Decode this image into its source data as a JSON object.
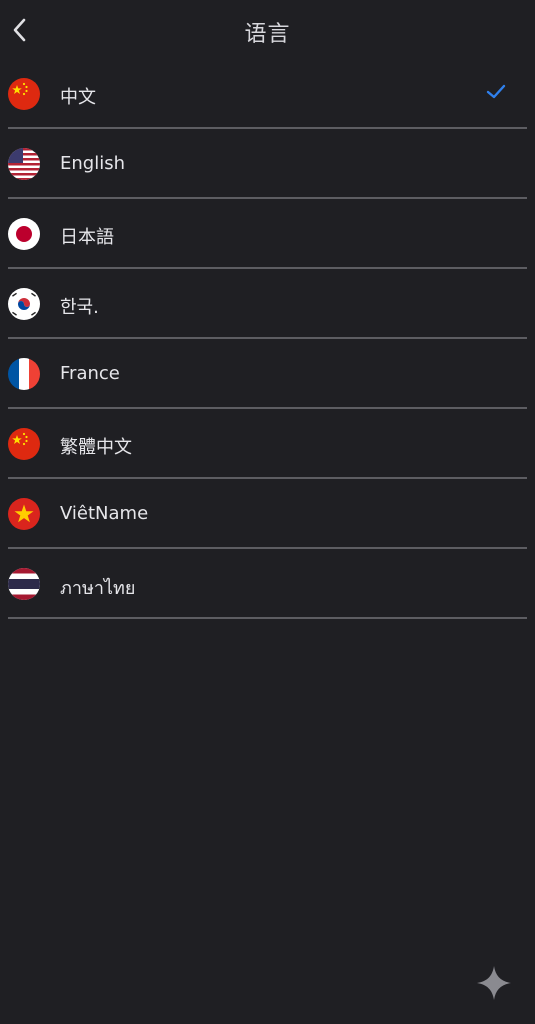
{
  "header": {
    "back_icon": "chevron-left-icon",
    "title": "语言"
  },
  "languages": [
    {
      "label": "中文",
      "flag": "china-flag-icon",
      "selected": true
    },
    {
      "label": "English",
      "flag": "usa-flag-icon",
      "selected": false
    },
    {
      "label": "日本語",
      "flag": "japan-flag-icon",
      "selected": false
    },
    {
      "label": "한국.",
      "flag": "korea-flag-icon",
      "selected": false
    },
    {
      "label": "France",
      "flag": "france-flag-icon",
      "selected": false
    },
    {
      "label": "繁體中文",
      "flag": "china-flag-icon",
      "selected": false
    },
    {
      "label": "ViêtName",
      "flag": "vietnam-flag-icon",
      "selected": false
    },
    {
      "label": "ภาษาไทย",
      "flag": "thailand-flag-icon",
      "selected": false
    }
  ],
  "check_icon": "checkmark-icon",
  "fab_icon": "sparkle-icon",
  "colors": {
    "background": "#1f1f23",
    "divider": "#5d5d62",
    "accent": "#2f80ed",
    "text": "#e6e6ea"
  }
}
